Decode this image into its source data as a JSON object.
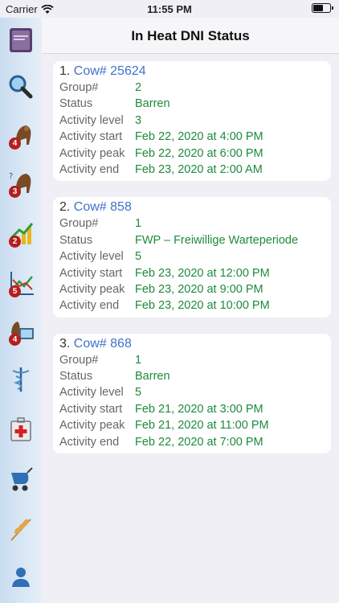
{
  "statusbar": {
    "carrier": "Carrier",
    "time": "11:55 PM"
  },
  "header": {
    "title": "In Heat DNI Status"
  },
  "sidebar": {
    "items": [
      {
        "icon": "book-icon",
        "badge": null
      },
      {
        "icon": "magnifier-icon",
        "badge": null
      },
      {
        "icon": "cow-icon",
        "badge": "4"
      },
      {
        "icon": "cow-question-icon",
        "badge": "3"
      },
      {
        "icon": "growth-chart-icon",
        "badge": "2"
      },
      {
        "icon": "trend-chart-icon",
        "badge": "5"
      },
      {
        "icon": "cow-monitor-icon",
        "badge": "4"
      },
      {
        "icon": "caduceus-icon",
        "badge": null
      },
      {
        "icon": "first-aid-icon",
        "badge": null
      },
      {
        "icon": "stroller-icon",
        "badge": null
      },
      {
        "icon": "wheat-icon",
        "badge": null
      },
      {
        "icon": "person-icon",
        "badge": null
      }
    ]
  },
  "labels": {
    "group": "Group#",
    "status": "Status",
    "activity_level": "Activity level",
    "activity_start": "Activity start",
    "activity_peak": "Activity peak",
    "activity_end": "Activity end"
  },
  "cows": [
    {
      "num": "1.",
      "cow": "Cow# 25624",
      "group": "2",
      "status": "Barren",
      "activity_level": "3",
      "activity_start": "Feb 22, 2020 at 4:00 PM",
      "activity_peak": "Feb 22, 2020 at 6:00 PM",
      "activity_end": "Feb 23, 2020 at 2:00 AM"
    },
    {
      "num": "2.",
      "cow": "Cow# 858",
      "group": "1",
      "status": "FWP – Freiwillige Warteperiode",
      "activity_level": "5",
      "activity_start": "Feb 23, 2020 at 12:00 PM",
      "activity_peak": "Feb 23, 2020 at 9:00 PM",
      "activity_end": "Feb 23, 2020 at 10:00 PM"
    },
    {
      "num": "3.",
      "cow": "Cow# 868",
      "group": "1",
      "status": "Barren",
      "activity_level": "5",
      "activity_start": "Feb 21, 2020 at 3:00 PM",
      "activity_peak": "Feb 21, 2020 at 11:00 PM",
      "activity_end": "Feb 22, 2020 at 7:00 PM"
    }
  ]
}
